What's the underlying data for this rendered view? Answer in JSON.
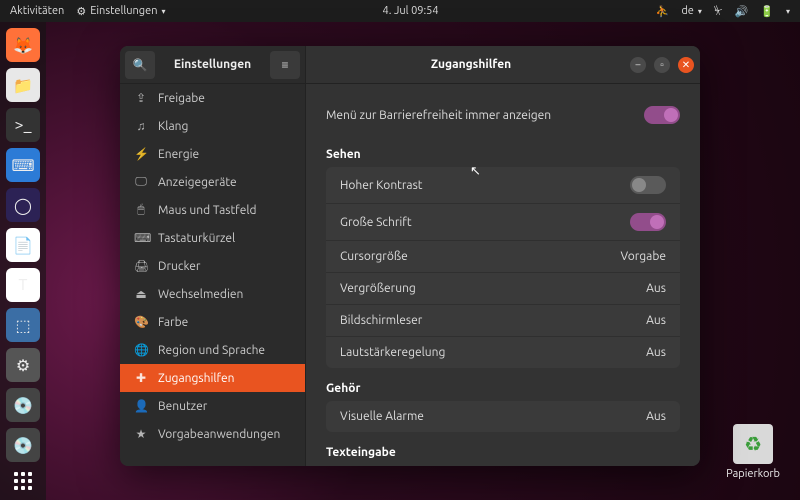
{
  "topbar": {
    "activities": "Aktivitäten",
    "app": "Einstellungen",
    "datetime": "4. Jul  09:54",
    "input": "de"
  },
  "dock_apps": [
    {
      "name": "firefox",
      "bg": "#ff7139",
      "glyph": "🦊"
    },
    {
      "name": "files",
      "bg": "#e8e8e8",
      "glyph": "📁"
    },
    {
      "name": "terminal",
      "bg": "#333",
      "glyph": ">_"
    },
    {
      "name": "vscode",
      "bg": "#2c7bd6",
      "glyph": "⌨"
    },
    {
      "name": "eclipse",
      "bg": "#2c2255",
      "glyph": "◯"
    },
    {
      "name": "libreoffice",
      "bg": "#fff",
      "glyph": "📄"
    },
    {
      "name": "text-editor",
      "bg": "#fff",
      "glyph": "T"
    },
    {
      "name": "screenshot",
      "bg": "#3b6ea5",
      "glyph": "⬚"
    },
    {
      "name": "settings",
      "bg": "#555",
      "glyph": "⚙"
    },
    {
      "name": "disc1",
      "bg": "#444",
      "glyph": "💿"
    },
    {
      "name": "disc2",
      "bg": "#444",
      "glyph": "💿"
    }
  ],
  "desktop": {
    "trash": "Papierkorb"
  },
  "window": {
    "sidebar_title": "Einstellungen",
    "content_title": "Zugangshilfen"
  },
  "sidebar": [
    {
      "icon": "⇪",
      "label": "Freigabe"
    },
    {
      "icon": "♫",
      "label": "Klang"
    },
    {
      "icon": "⚡",
      "label": "Energie"
    },
    {
      "icon": "🖵",
      "label": "Anzeigegeräte"
    },
    {
      "icon": "🖱",
      "label": "Maus und Tastfeld"
    },
    {
      "icon": "⌨",
      "label": "Tastaturkürzel"
    },
    {
      "icon": "🖨",
      "label": "Drucker"
    },
    {
      "icon": "⏏",
      "label": "Wechselmedien"
    },
    {
      "icon": "🎨",
      "label": "Farbe"
    },
    {
      "icon": "🌐",
      "label": "Region und Sprache"
    },
    {
      "icon": "✚",
      "label": "Zugangshilfen",
      "selected": true
    },
    {
      "icon": "👤",
      "label": "Benutzer"
    },
    {
      "icon": "★",
      "label": "Vorgabeanwendungen"
    }
  ],
  "content": {
    "always_show": {
      "label": "Menü zur Barrierefreiheit immer anzeigen",
      "on": true
    },
    "section_sehen": "Sehen",
    "sehen_rows": [
      {
        "label": "Hoher Kontrast",
        "type": "toggle",
        "on": false
      },
      {
        "label": "Große Schrift",
        "type": "toggle",
        "on": true
      },
      {
        "label": "Cursorgröße",
        "type": "value",
        "value": "Vorgabe"
      },
      {
        "label": "Vergrößerung",
        "type": "value",
        "value": "Aus"
      },
      {
        "label": "Bildschirmleser",
        "type": "value",
        "value": "Aus"
      },
      {
        "label": "Lautstärkeregelung",
        "type": "value",
        "value": "Aus"
      }
    ],
    "section_gehoer": "Gehör",
    "gehoer_rows": [
      {
        "label": "Visuelle Alarme",
        "type": "value",
        "value": "Aus"
      }
    ],
    "section_text": "Texteingabe"
  }
}
